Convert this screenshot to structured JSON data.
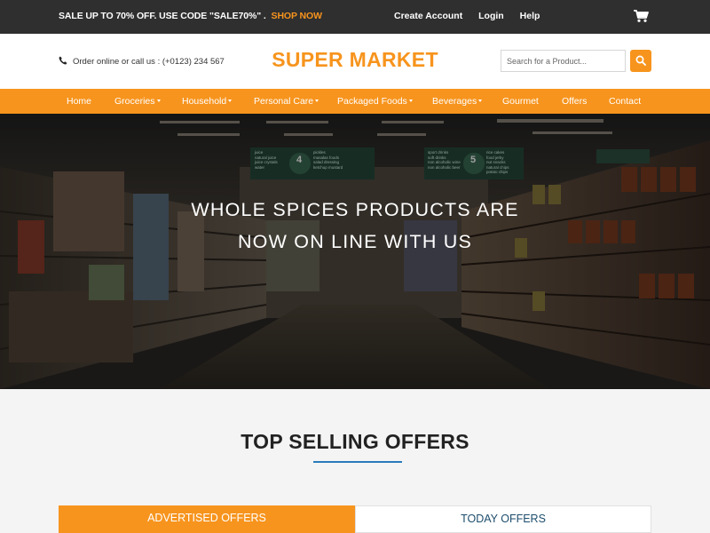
{
  "topbar": {
    "promo_text": "SALE UP TO 70% OFF. USE CODE \"SALE70%\" .",
    "shop_now": "SHOP NOW",
    "links": [
      "Create Account",
      "Login",
      "Help"
    ],
    "cart_icon": "shopping-cart-icon"
  },
  "header": {
    "contact_text": "Order online or call us : (+0123) 234 567",
    "phone_icon": "phone-icon",
    "logo": "SUPER MARKET",
    "search_placeholder": "Search for a Product...",
    "search_icon": "search-icon"
  },
  "nav": {
    "items": [
      {
        "label": "Home",
        "dropdown": false
      },
      {
        "label": "Groceries",
        "dropdown": true
      },
      {
        "label": "Household",
        "dropdown": true
      },
      {
        "label": "Personal Care",
        "dropdown": true
      },
      {
        "label": "Packaged Foods",
        "dropdown": true
      },
      {
        "label": "Beverages",
        "dropdown": true
      },
      {
        "label": "Gourmet",
        "dropdown": false
      },
      {
        "label": "Offers",
        "dropdown": false
      },
      {
        "label": "Contact",
        "dropdown": false
      }
    ]
  },
  "hero": {
    "line1": "WHOLE SPICES PRODUCTS ARE",
    "line2": "NOW ON LINE WITH US",
    "aisle_signs": [
      {
        "number": "4",
        "items": [
          "juice",
          "natural juice",
          "juice crystals",
          "water",
          "pickles",
          "masalas foods",
          "salad dressing",
          "ketchup mustard"
        ]
      },
      {
        "number": "5",
        "items": [
          "sport drinks",
          "soft drinks",
          "non alcoholic wine",
          "non alcoholic beer",
          "rice cakes",
          "food jerky",
          "nut snacks",
          "natural chips",
          "potato chips"
        ]
      }
    ]
  },
  "offers": {
    "title": "TOP SELLING OFFERS",
    "tabs": [
      {
        "label": "ADVERTISED OFFERS",
        "active": true
      },
      {
        "label": "TODAY OFFERS",
        "active": false
      }
    ]
  },
  "colors": {
    "accent": "#f7941d",
    "topbar_bg": "#2f2f2f",
    "divider_blue": "#2b7bb9",
    "tab_inactive_text": "#1d4d6d"
  }
}
